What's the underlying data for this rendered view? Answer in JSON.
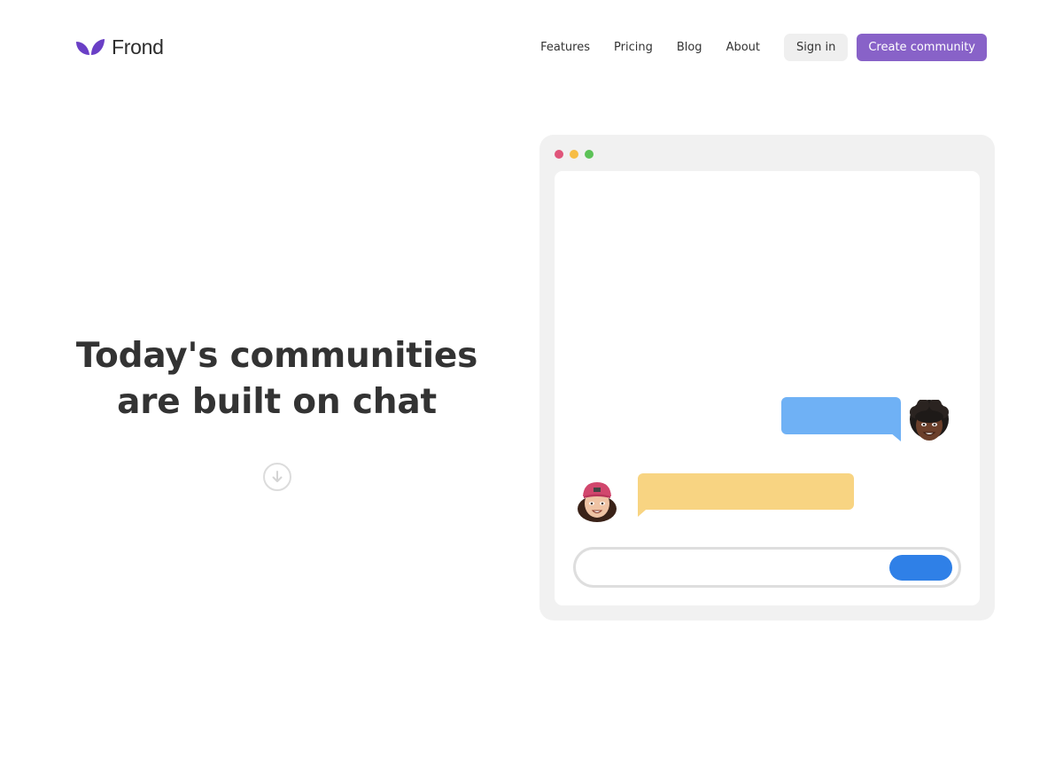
{
  "brand": {
    "name": "Frond",
    "logo_icon": "leaf-icon",
    "accent_color": "#6a3fc6"
  },
  "nav": {
    "links": [
      {
        "label": "Features"
      },
      {
        "label": "Pricing"
      },
      {
        "label": "Blog"
      },
      {
        "label": "About"
      }
    ],
    "signin_label": "Sign in",
    "create_label": "Create community",
    "create_color": "#8862c8"
  },
  "hero": {
    "title_line1": "Today's communities",
    "title_line2": "are built on chat",
    "scroll_icon": "arrow-down-circle-icon"
  },
  "mockup": {
    "window_controls": [
      "close",
      "minimize",
      "maximize"
    ],
    "messages": [
      {
        "side": "right",
        "color": "#6fb1f5",
        "avatar": "memoji-boy"
      },
      {
        "side": "left",
        "color": "#f8d482",
        "avatar": "memoji-girl"
      }
    ],
    "input_placeholder": "",
    "send_color": "#2f80e7"
  }
}
